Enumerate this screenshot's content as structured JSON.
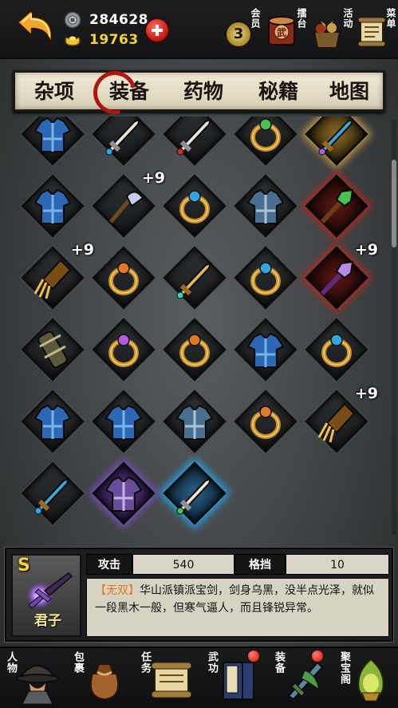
{
  "currency": {
    "silver": "284628",
    "gold": "19763"
  },
  "top_menu": {
    "vip_level": "3",
    "vip_label": "会员",
    "arena_label": "擂台",
    "event_label": "活动",
    "task_label": "菜单"
  },
  "tabs": [
    {
      "label": "杂项",
      "active": false
    },
    {
      "label": "装备",
      "active": true
    },
    {
      "label": "药物",
      "active": false
    },
    {
      "label": "秘籍",
      "active": false
    },
    {
      "label": "地图",
      "active": false
    }
  ],
  "inventory": [
    {
      "item": "blue-robe-icon",
      "quality": "normal",
      "plus": ""
    },
    {
      "item": "sword-hilt-icon",
      "quality": "normal",
      "plus": "+"
    },
    {
      "item": "jade-sword-icon",
      "quality": "normal",
      "plus": "+"
    },
    {
      "item": "turquoise-ring-icon",
      "quality": "normal",
      "plus": ""
    },
    {
      "item": "golden-dragon-blade-icon",
      "quality": "gold",
      "plus": "+"
    },
    {
      "item": "teal-robe-icon",
      "quality": "normal",
      "plus": ""
    },
    {
      "item": "blue-axe-icon",
      "quality": "normal",
      "plus": "+9"
    },
    {
      "item": "silver-ring-icon",
      "quality": "normal",
      "plus": ""
    },
    {
      "item": "steel-armor-icon",
      "quality": "normal",
      "plus": ""
    },
    {
      "item": "green-staff-icon",
      "quality": "red",
      "plus": ""
    },
    {
      "item": "claw-gauntlet-icon",
      "quality": "normal",
      "plus": "+9"
    },
    {
      "item": "ruby-ring-icon",
      "quality": "normal",
      "plus": ""
    },
    {
      "item": "golden-dagger-icon",
      "quality": "normal",
      "plus": ""
    },
    {
      "item": "ruby-gold-ring-icon",
      "quality": "normal",
      "plus": ""
    },
    {
      "item": "purple-spike-mace-icon",
      "quality": "red",
      "plus": "+9"
    },
    {
      "item": "bracer-icon",
      "quality": "normal",
      "plus": ""
    },
    {
      "item": "emerald-ring-icon",
      "quality": "normal",
      "plus": ""
    },
    {
      "item": "black-ring-icon",
      "quality": "normal",
      "plus": ""
    },
    {
      "item": "orange-robe-icon",
      "quality": "normal",
      "plus": ""
    },
    {
      "item": "coral-ring-icon",
      "quality": "normal",
      "plus": ""
    },
    {
      "item": "purple-robe-icon",
      "quality": "normal",
      "plus": ""
    },
    {
      "item": "green-robe-icon",
      "quality": "normal",
      "plus": ""
    },
    {
      "item": "dark-armor-icon",
      "quality": "normal",
      "plus": ""
    },
    {
      "item": "amethyst-ring-icon",
      "quality": "normal",
      "plus": ""
    },
    {
      "item": "golden-gauntlet-icon",
      "quality": "normal",
      "plus": "+9"
    },
    {
      "item": "golden-blade-icon",
      "quality": "normal",
      "plus": ""
    },
    {
      "item": "purple-plate-armor-icon",
      "quality": "purple",
      "plus": ""
    },
    {
      "item": "junzi-sword-icon",
      "quality": "blue",
      "plus": ""
    }
  ],
  "detail": {
    "grade": "S",
    "name": "君子",
    "stat1_label": "攻击",
    "stat1_value": "540",
    "stat2_label": "格挡",
    "stat2_value": "10",
    "tag": "【无双】",
    "description": "华山派镇派宝剑，剑身乌黑，没半点光泽，就似一段黑木一般，但寒气逼人，而且锋锐异常。"
  },
  "bottom_nav": [
    {
      "label": "人物",
      "icon": "hero-portrait-icon",
      "badge": false
    },
    {
      "label": "包裹",
      "icon": "bag-icon",
      "badge": false
    },
    {
      "label": "任务",
      "icon": "scroll-icon",
      "badge": false
    },
    {
      "label": "武功",
      "icon": "martial-book-icon",
      "badge": true
    },
    {
      "label": "装备",
      "icon": "equipment-icon",
      "badge": true
    },
    {
      "label": "聚宝阁",
      "icon": "treasure-pavilion-icon",
      "badge": false
    }
  ],
  "colors": {
    "gold_text": "#f4d33a",
    "tag_orange": "#e5761f",
    "active_tab_ring": "#b01611"
  }
}
